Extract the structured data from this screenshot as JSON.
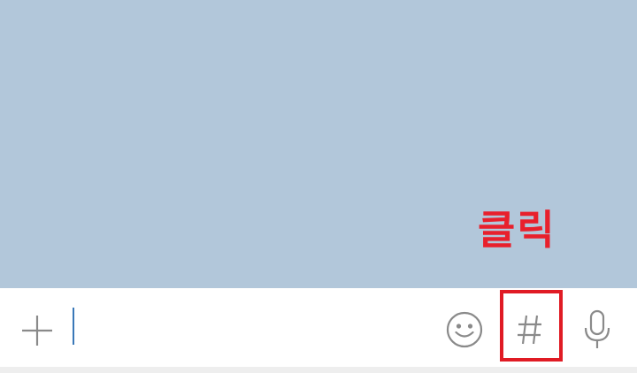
{
  "annotation": {
    "label": "클릭",
    "color": "#e8202c"
  },
  "chat": {
    "background_color": "#b2c7da"
  },
  "input_bar": {
    "add_icon": "plus-icon",
    "message_value": "",
    "emoji_icon": "smiley-icon",
    "hashtag_icon": "hash-icon",
    "mic_icon": "microphone-icon",
    "highlight_color": "#e01b24"
  }
}
